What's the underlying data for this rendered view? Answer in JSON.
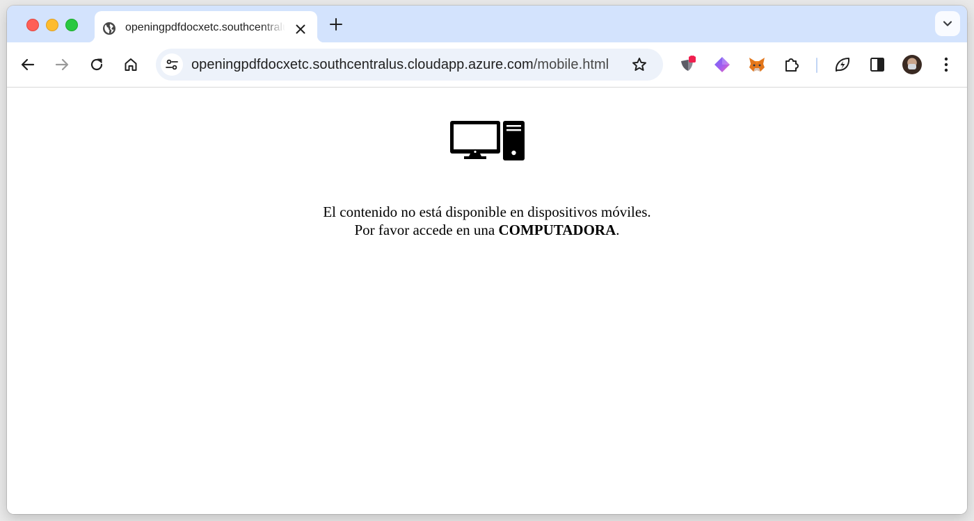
{
  "browser": {
    "tab": {
      "title": "openingpdfdocxetc.southcentralus.cloudapp.azure.com/mobile.html",
      "favicon": "globe-icon",
      "close_icon": "close-icon"
    },
    "new_tab_icon": "plus-icon",
    "tab_search_icon": "chevron-down-icon",
    "toolbar": {
      "back_icon": "back-arrow-icon",
      "forward_icon": "forward-arrow-icon",
      "reload_icon": "reload-icon",
      "home_icon": "home-icon"
    },
    "address_bar": {
      "host": "openingpdfdocxetc.southcentralus.cloudapp.azure.com",
      "path": "/mobile.html",
      "site_info_icon": "tune-icon",
      "bookmark_icon": "star-icon"
    },
    "extensions": [
      "shield-extension-icon",
      "diamond-extension-icon",
      "fox-extension-icon",
      "puzzle-icon",
      "leaf-bolt-icon",
      "side-panel-icon"
    ],
    "profile": "avatar",
    "menu_icon": "kebab-menu-icon"
  },
  "page": {
    "illustration": "desktop-computer-icon",
    "line1": "El contenido no está disponible en dispositivos móviles.",
    "line2_prefix": "Por favor accede en una ",
    "line2_emphasis": "COMPUTADORA",
    "line2_suffix": "."
  },
  "colors": {
    "tabstrip": "#d3e3fd",
    "omnibox": "#edf2fa",
    "icon": "#1f1f1f"
  }
}
